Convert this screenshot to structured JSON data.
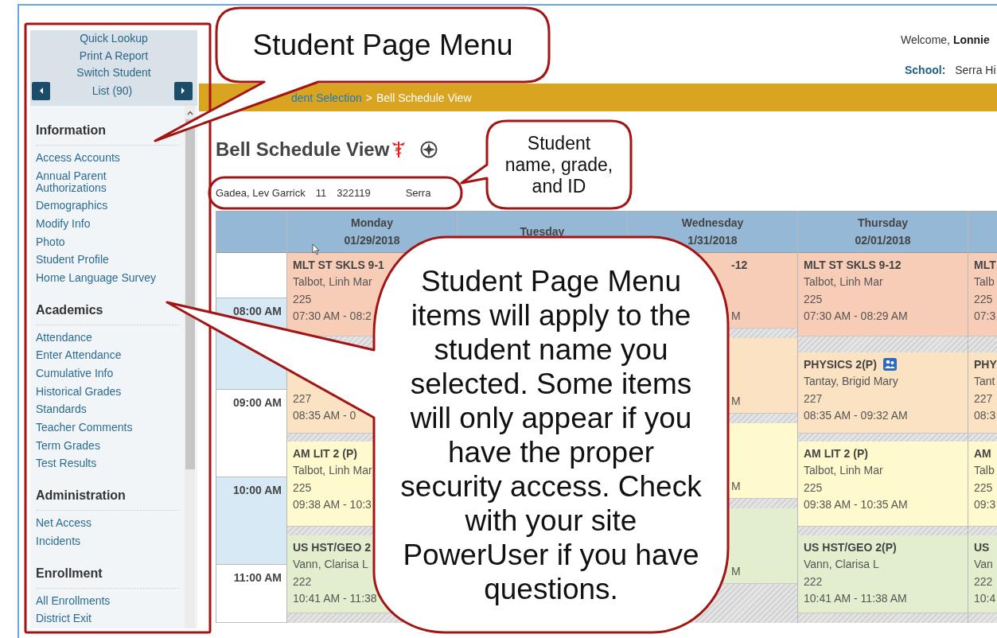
{
  "sidebar": {
    "quick_links": [
      "Quick Lookup",
      "Print A Report",
      "Switch Student"
    ],
    "list_label": "List (90)",
    "sections": [
      {
        "title": "Information",
        "items": [
          "Access Accounts",
          "Annual Parent Authorizations",
          "Demographics",
          "Modify Info",
          "Photo",
          "Student Profile",
          "Home Language Survey"
        ]
      },
      {
        "title": "Academics",
        "items": [
          "Attendance",
          "Enter Attendance",
          "Cumulative Info",
          "Historical Grades",
          "Standards",
          "Teacher Comments",
          "Term Grades",
          "Test Results"
        ]
      },
      {
        "title": "Administration",
        "items": [
          "Net Access",
          "Incidents"
        ]
      },
      {
        "title": "Enrollment",
        "items": [
          "All Enrollments",
          "District Exit"
        ]
      }
    ]
  },
  "header": {
    "welcome": "Welcome, **Lonnie**",
    "school_label": "School:",
    "school": "Serra Hi"
  },
  "breadcrumb": {
    "link": "dent Selection",
    "separator": ">",
    "current": "Bell Schedule View"
  },
  "page_title": "Bell Schedule View",
  "student": {
    "name": "Gadea, Lev Garrick",
    "grade": "11",
    "id": "322119",
    "school": "Serra"
  },
  "schedule": {
    "times": [
      "08:00 AM",
      "09:00 AM",
      "10:00 AM",
      "11:00 AM"
    ],
    "days": [
      {
        "day": "Monday",
        "date": "01/29/2018",
        "kind": "regular",
        "events": [
          {
            "kind": "full",
            "title": "MLT ST SKLS 9-1",
            "teacher": "Talbot, Linh Mar",
            "room": "225",
            "time": "07:30 AM - 08:2",
            "color": "#f8cdb8",
            "has_icon": false
          },
          {
            "kind": "full",
            "room": "227",
            "time": "08:35 AM - 0",
            "color": "#fbe2c2",
            "has_icon": false
          },
          {
            "kind": "full",
            "title": "AM LIT 2 (P)",
            "teacher": "Talbot, Linh Mar",
            "room": "225",
            "time": "09:38 AM - 10:3",
            "color": "#fffacd",
            "has_icon": false
          },
          {
            "kind": "full",
            "title": "US HST/GEO 2",
            "teacher": "Vann, Clarisa L",
            "room": "222",
            "time": "10:41 AM - 11:38",
            "color": "#e2eecd",
            "has_icon": false
          }
        ]
      },
      {
        "day": "Tuesday"
      },
      {
        "day": "Wednesday",
        "date": "1/31/2018",
        "kind": "short",
        "events": [
          {
            "kind": "partial",
            "title": "-12",
            "time": "M",
            "color": "#f8cdb8",
            "has_icon": false
          },
          {
            "kind": "partial",
            "time": "M",
            "color": "#fbe2c2",
            "has_icon": false
          },
          {
            "kind": "partial",
            "time": "M",
            "color": "#fffacd",
            "has_icon": false
          },
          {
            "kind": "partial",
            "time": "M",
            "color": "#e2eecd",
            "has_icon": false
          }
        ]
      },
      {
        "day": "Thursday",
        "date": "02/01/2018",
        "kind": "regular",
        "events": [
          {
            "kind": "full",
            "title": "MLT ST SKLS 9-12",
            "teacher": "Talbot, Linh Mar",
            "room": "225",
            "time": "07:30 AM - 08:29 AM",
            "color": "#f8cdb8",
            "has_icon": false
          },
          {
            "kind": "full",
            "title": "PHYSICS 2(P)",
            "teacher": "Tantay, Brigid Mary",
            "room": "227",
            "time": "08:35 AM - 09:32 AM",
            "color": "#fbe2c2",
            "has_icon": true
          },
          {
            "kind": "full",
            "title": "AM LIT 2 (P)",
            "teacher": "Talbot, Linh Mar",
            "room": "225",
            "time": "09:38 AM - 10:35 AM",
            "color": "#fffacd",
            "has_icon": false
          },
          {
            "kind": "full",
            "title": "US HST/GEO 2(P)",
            "teacher": "Vann, Clarisa L",
            "room": "222",
            "time": "10:41 AM - 11:38 AM",
            "color": "#e2eecd",
            "has_icon": false
          }
        ]
      },
      {
        "kind": "regular",
        "events": [
          {
            "kind": "full",
            "title": "MLT",
            "teacher": "Talb",
            "room": "225",
            "time": "07:3",
            "color": "#f8cdb8",
            "has_icon": false
          },
          {
            "kind": "full",
            "title": "PHY",
            "teacher": "Tant",
            "room": "227",
            "time": "08:3",
            "color": "#fbe2c2",
            "has_icon": false
          },
          {
            "kind": "full",
            "title": "AM",
            "teacher": "Talb",
            "room": "225",
            "time": "09:3",
            "color": "#fffacd",
            "has_icon": false
          },
          {
            "kind": "full",
            "title": "US",
            "teacher": "Van",
            "room": "222",
            "time": "10:4",
            "color": "#e2eecd",
            "has_icon": false
          }
        ]
      }
    ]
  },
  "callouts": [
    {
      "text": "Student Page Menu"
    },
    {
      "text": "Student name, grade, and ID"
    },
    {
      "text": "Student Page Menu items will apply to the student name you selected. Some items will only appear if you have the proper security access. Check with your site PowerUser if you have questions."
    }
  ]
}
